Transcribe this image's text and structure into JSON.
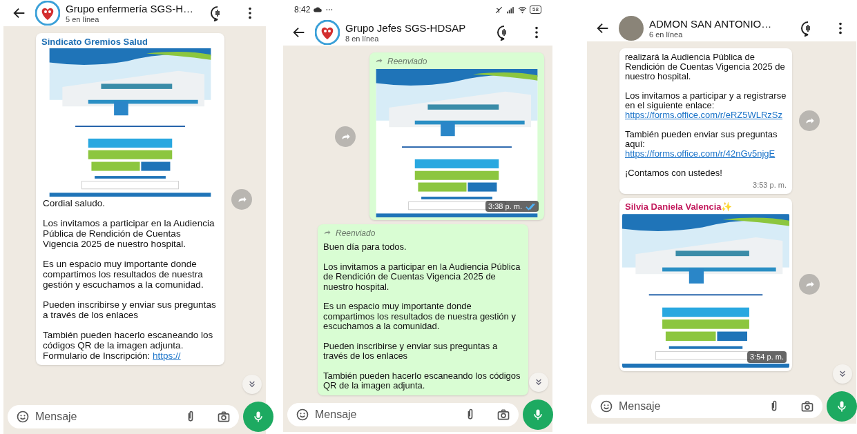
{
  "phones": [
    {
      "header": {
        "title": "Grupo enfermería SGS-H…",
        "subtitle": "5 en línea",
        "avatar": {
          "kind": "logo"
        }
      },
      "scroll_down": true,
      "messages": [
        {
          "outgoing": false,
          "sender": "Sindicato Gremios Salud",
          "color": "#1f6fb3",
          "forwarded": false,
          "image": true,
          "forward_button": true,
          "paragraphs": [
            {
              "text": "Cordial saludo."
            },
            {
              "text": "Los invitamos a participar en la Audiencia Pública de Rendición de Cuentas Vigencia 2025 de nuestro hospital."
            },
            {
              "text": "Es un espacio muy importante donde compartimos los resultados de nuestra gestión y escuchamos a la comunidad."
            },
            {
              "text": "Pueden inscribirse y enviar sus preguntas a través de los enlaces"
            },
            {
              "text": "También pueden hacerlo escaneando los códigos QR de la imagen adjunta.\nFormulario de Inscripción:",
              "link": "https://"
            }
          ]
        }
      ],
      "composer": {
        "placeholder": "Mensaje"
      }
    },
    {
      "status_bar": {
        "time": "8:42",
        "battery": "58"
      },
      "header": {
        "title": "Grupo Jefes SGS-HDSAP",
        "subtitle": "8 en línea",
        "avatar": {
          "kind": "logo"
        }
      },
      "scroll_down": true,
      "messages": [
        {
          "outgoing": true,
          "forwarded": true,
          "forwarded_label": "Reenviado",
          "image": true,
          "forward_button": true,
          "time": "3:38 p. m.",
          "read": true
        },
        {
          "outgoing": true,
          "forwarded": true,
          "forwarded_label": "Reenviado",
          "image": false,
          "forward_button": false,
          "paragraphs": [
            {
              "text": "Buen día para todos."
            },
            {
              "text": "Los invitamos a participar en la Audiencia Pública de Rendición de Cuentas Vigencia 2025 de nuestro hospital."
            },
            {
              "text": "Es un espacio muy importante donde compartimos los resultados de nuestra gestión y escuchamos a la comunidad."
            },
            {
              "text": "Pueden inscribirse y enviar sus preguntas a través de los enlaces"
            },
            {
              "text": "También pueden hacerlo escaneando los códigos QR de la imagen adjunta."
            }
          ]
        }
      ],
      "composer": {
        "placeholder": "Mensaje"
      }
    },
    {
      "header": {
        "title": "ADMON SAN ANTONIO…",
        "subtitle": "6 en línea",
        "avatar": {
          "kind": "photo"
        }
      },
      "scroll_down": true,
      "messages": [
        {
          "outgoing": false,
          "forwarded": false,
          "image": false,
          "forward_button": true,
          "time": "3:53 p. m.",
          "paragraphs": [
            {
              "text": "realizará la Audiencia Pública de Rendición de Cuentas Vigencia 2025 de nuestro hospital."
            },
            {
              "text": "Los invitamos a participar y a registrarse en el siguiente enlace:",
              "link": "https://forms.office.com/r/eRZ5WLRzSz"
            },
            {
              "text": "También pueden enviar sus preguntas aquí:",
              "link": "https://forms.office.com/r/42nGv5njgE"
            },
            {
              "text": "¡Contamos con ustedes!"
            }
          ]
        },
        {
          "outgoing": false,
          "sender": "Silvia Daniela Valencia✨",
          "color": "#c2185b",
          "forwarded": false,
          "image": true,
          "forward_button": true,
          "time": "3:54 p. m."
        }
      ],
      "composer": {
        "placeholder": "Mensaje"
      }
    }
  ]
}
